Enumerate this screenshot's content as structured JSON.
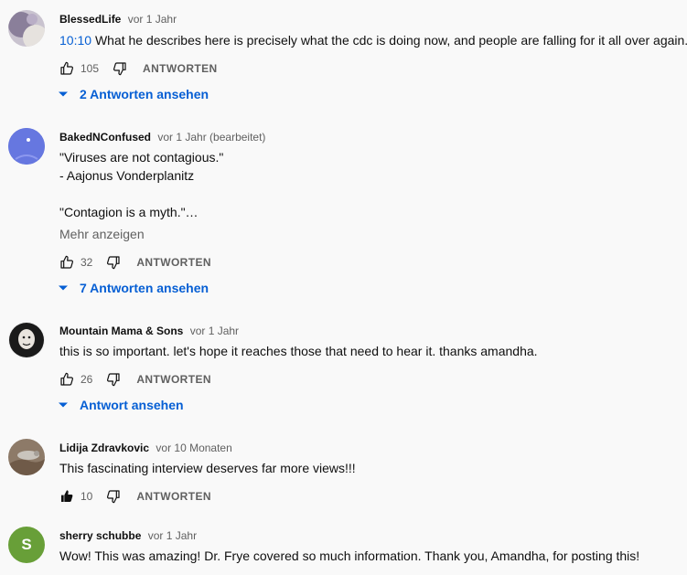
{
  "comments": [
    {
      "author": "BlessedLife",
      "meta": "vor 1 Jahr",
      "timestamp_link": "10:10",
      "lines": [
        "What he describes here is precisely what the cdc is doing now, and people are falling for it all over again."
      ],
      "likes": "105",
      "reply_label": "ANTWORTEN",
      "replies_label": "2 Antworten ansehen"
    },
    {
      "author": "BakedNConfused",
      "meta": "vor 1 Jahr (bearbeitet)",
      "lines": [
        "\"Viruses are not contagious.\"",
        "- Aajonus Vonderplanitz",
        "",
        "\"Contagion is a myth.\"…"
      ],
      "show_more": "Mehr anzeigen",
      "likes": "32",
      "reply_label": "ANTWORTEN",
      "replies_label": "7 Antworten ansehen"
    },
    {
      "author": "Mountain Mama & Sons",
      "meta": "vor 1 Jahr",
      "lines": [
        "this is so important. let's hope it reaches those that need to hear it. thanks amandha."
      ],
      "likes": "26",
      "reply_label": "ANTWORTEN",
      "replies_label": "Antwort ansehen"
    },
    {
      "author": "Lidija Zdravkovic",
      "meta": "vor 10 Monaten",
      "lines": [
        "This fascinating interview deserves far more views!!!"
      ],
      "likes": "10",
      "liked": true,
      "reply_label": "ANTWORTEN"
    },
    {
      "author": "sherry schubbe",
      "meta": "vor 1 Jahr",
      "avatar_letter": "S",
      "lines": [
        "Wow! This was amazing! Dr. Frye covered so much information.  Thank you, Amandha, for posting this!"
      ]
    }
  ],
  "icons": {
    "like": "thumbs-up-icon",
    "dislike": "thumbs-down-icon",
    "expand": "chevron-down-icon"
  },
  "colors": {
    "link_blue": "#065fd4",
    "meta_gray": "#606060",
    "avatar_green": "#689f38"
  }
}
